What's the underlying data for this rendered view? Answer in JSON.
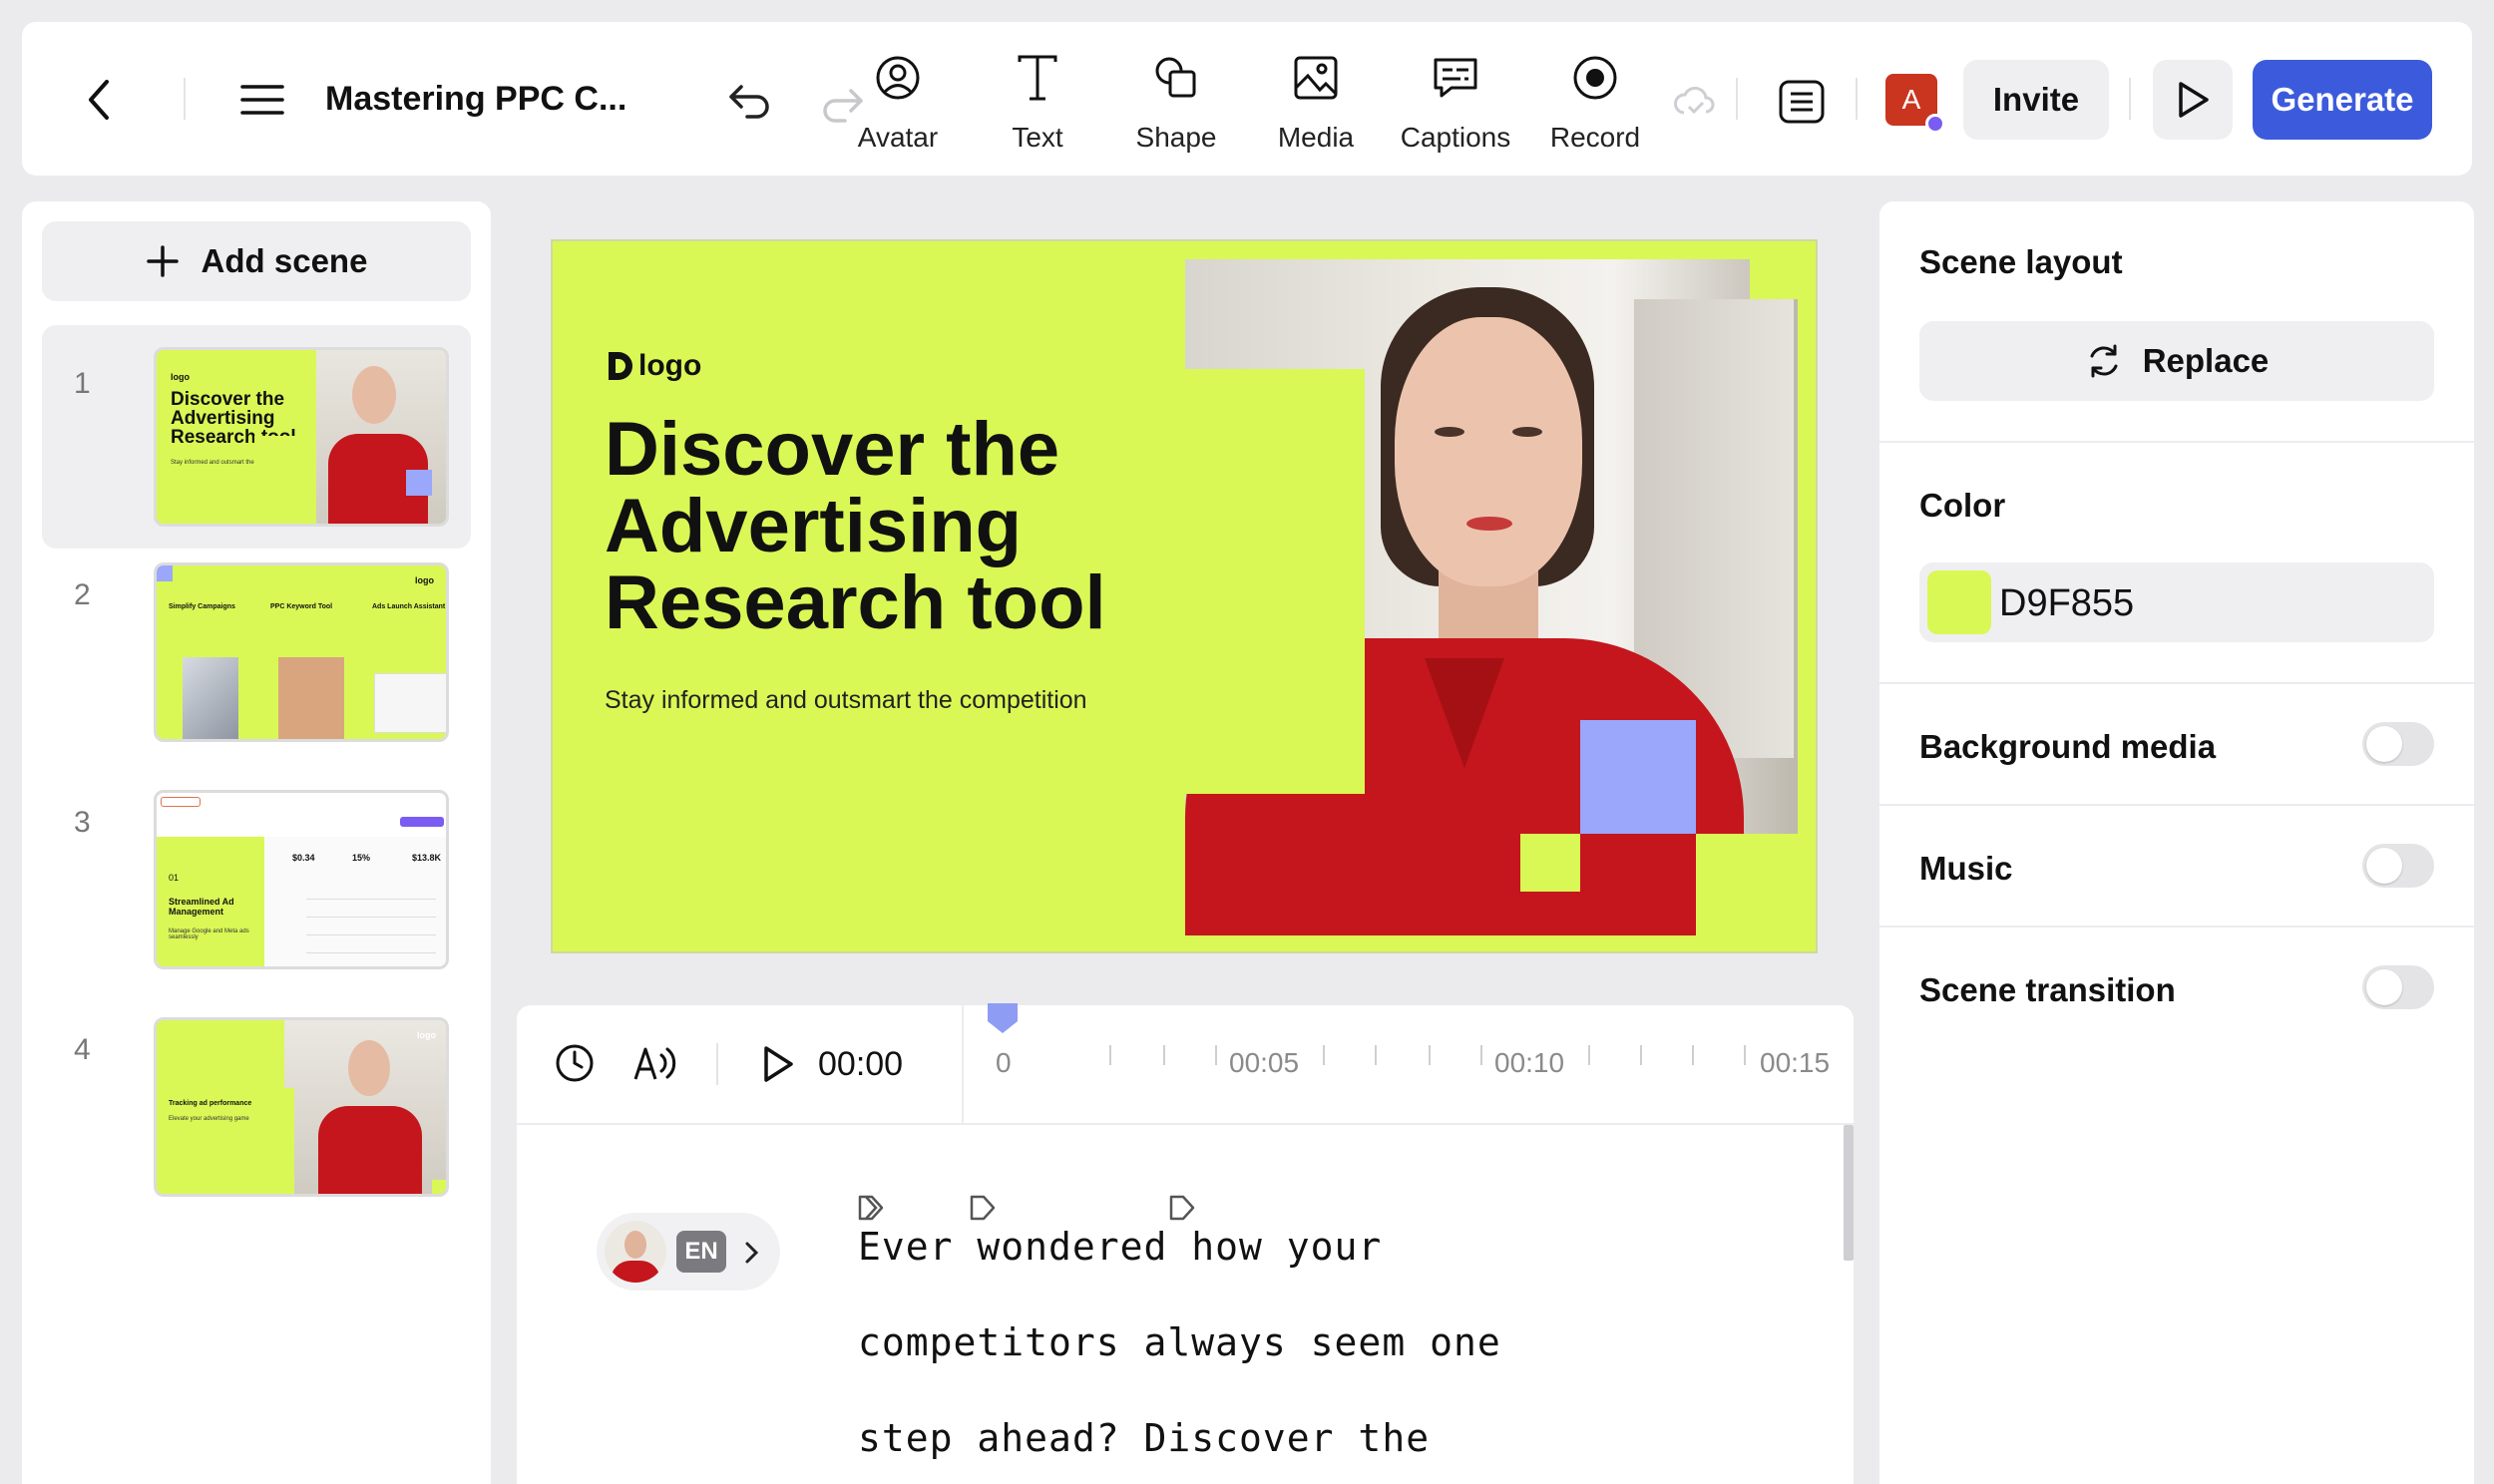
{
  "topbar": {
    "doc_title": "Mastering PPC C...",
    "tools": [
      {
        "label": "Avatar",
        "icon": "avatar-icon"
      },
      {
        "label": "Text",
        "icon": "text-icon"
      },
      {
        "label": "Shape",
        "icon": "shape-icon"
      },
      {
        "label": "Media",
        "icon": "media-icon"
      },
      {
        "label": "Captions",
        "icon": "captions-icon"
      },
      {
        "label": "Record",
        "icon": "record-icon"
      }
    ],
    "user_initial": "A",
    "invite_label": "Invite",
    "generate_label": "Generate"
  },
  "sidebar": {
    "add_scene_label": "Add scene",
    "scenes": [
      {
        "number": "1",
        "title": "Discover the Advertising Research tool",
        "sub": "Stay informed and outsmart the competition",
        "logo": "logo"
      },
      {
        "number": "2",
        "cols": [
          "Simplify Campaigns",
          "PPC Keyword Tool",
          "Ads Launch Assistant"
        ],
        "logo": "logo"
      },
      {
        "number": "3",
        "num": "01",
        "title": "Streamlined Ad Management",
        "sub": "Manage Google and Meta ads seamlessly",
        "stats": [
          "$0.34",
          "15%",
          "$13.8K"
        ]
      },
      {
        "number": "4",
        "title": "Tracking ad performance",
        "sub": "Elevate your advertising game",
        "logo": "logo"
      }
    ]
  },
  "slide": {
    "logo": "logo",
    "title_lines": [
      "Discover the",
      "Advertising",
      "Research tool"
    ],
    "subtitle": "Stay informed and outsmart the competition"
  },
  "timeline": {
    "current_time": "00:00",
    "marks": [
      "0",
      "00:05",
      "00:10",
      "00:15"
    ]
  },
  "script": {
    "language": "EN",
    "lines": [
      "Ever wondered how your",
      "competitors always seem one",
      "step ahead? Discover the"
    ]
  },
  "rightpanel": {
    "scene_layout_label": "Scene layout",
    "replace_label": "Replace",
    "color_label": "Color",
    "color_value": "D9F855",
    "background_media_label": "Background media",
    "music_label": "Music",
    "scene_transition_label": "Scene transition"
  },
  "colors": {
    "accent": "#d9f855",
    "primary_button": "#3c5bdc",
    "square_blue": "#9aa7fb",
    "shirt_red": "#c4161c"
  }
}
